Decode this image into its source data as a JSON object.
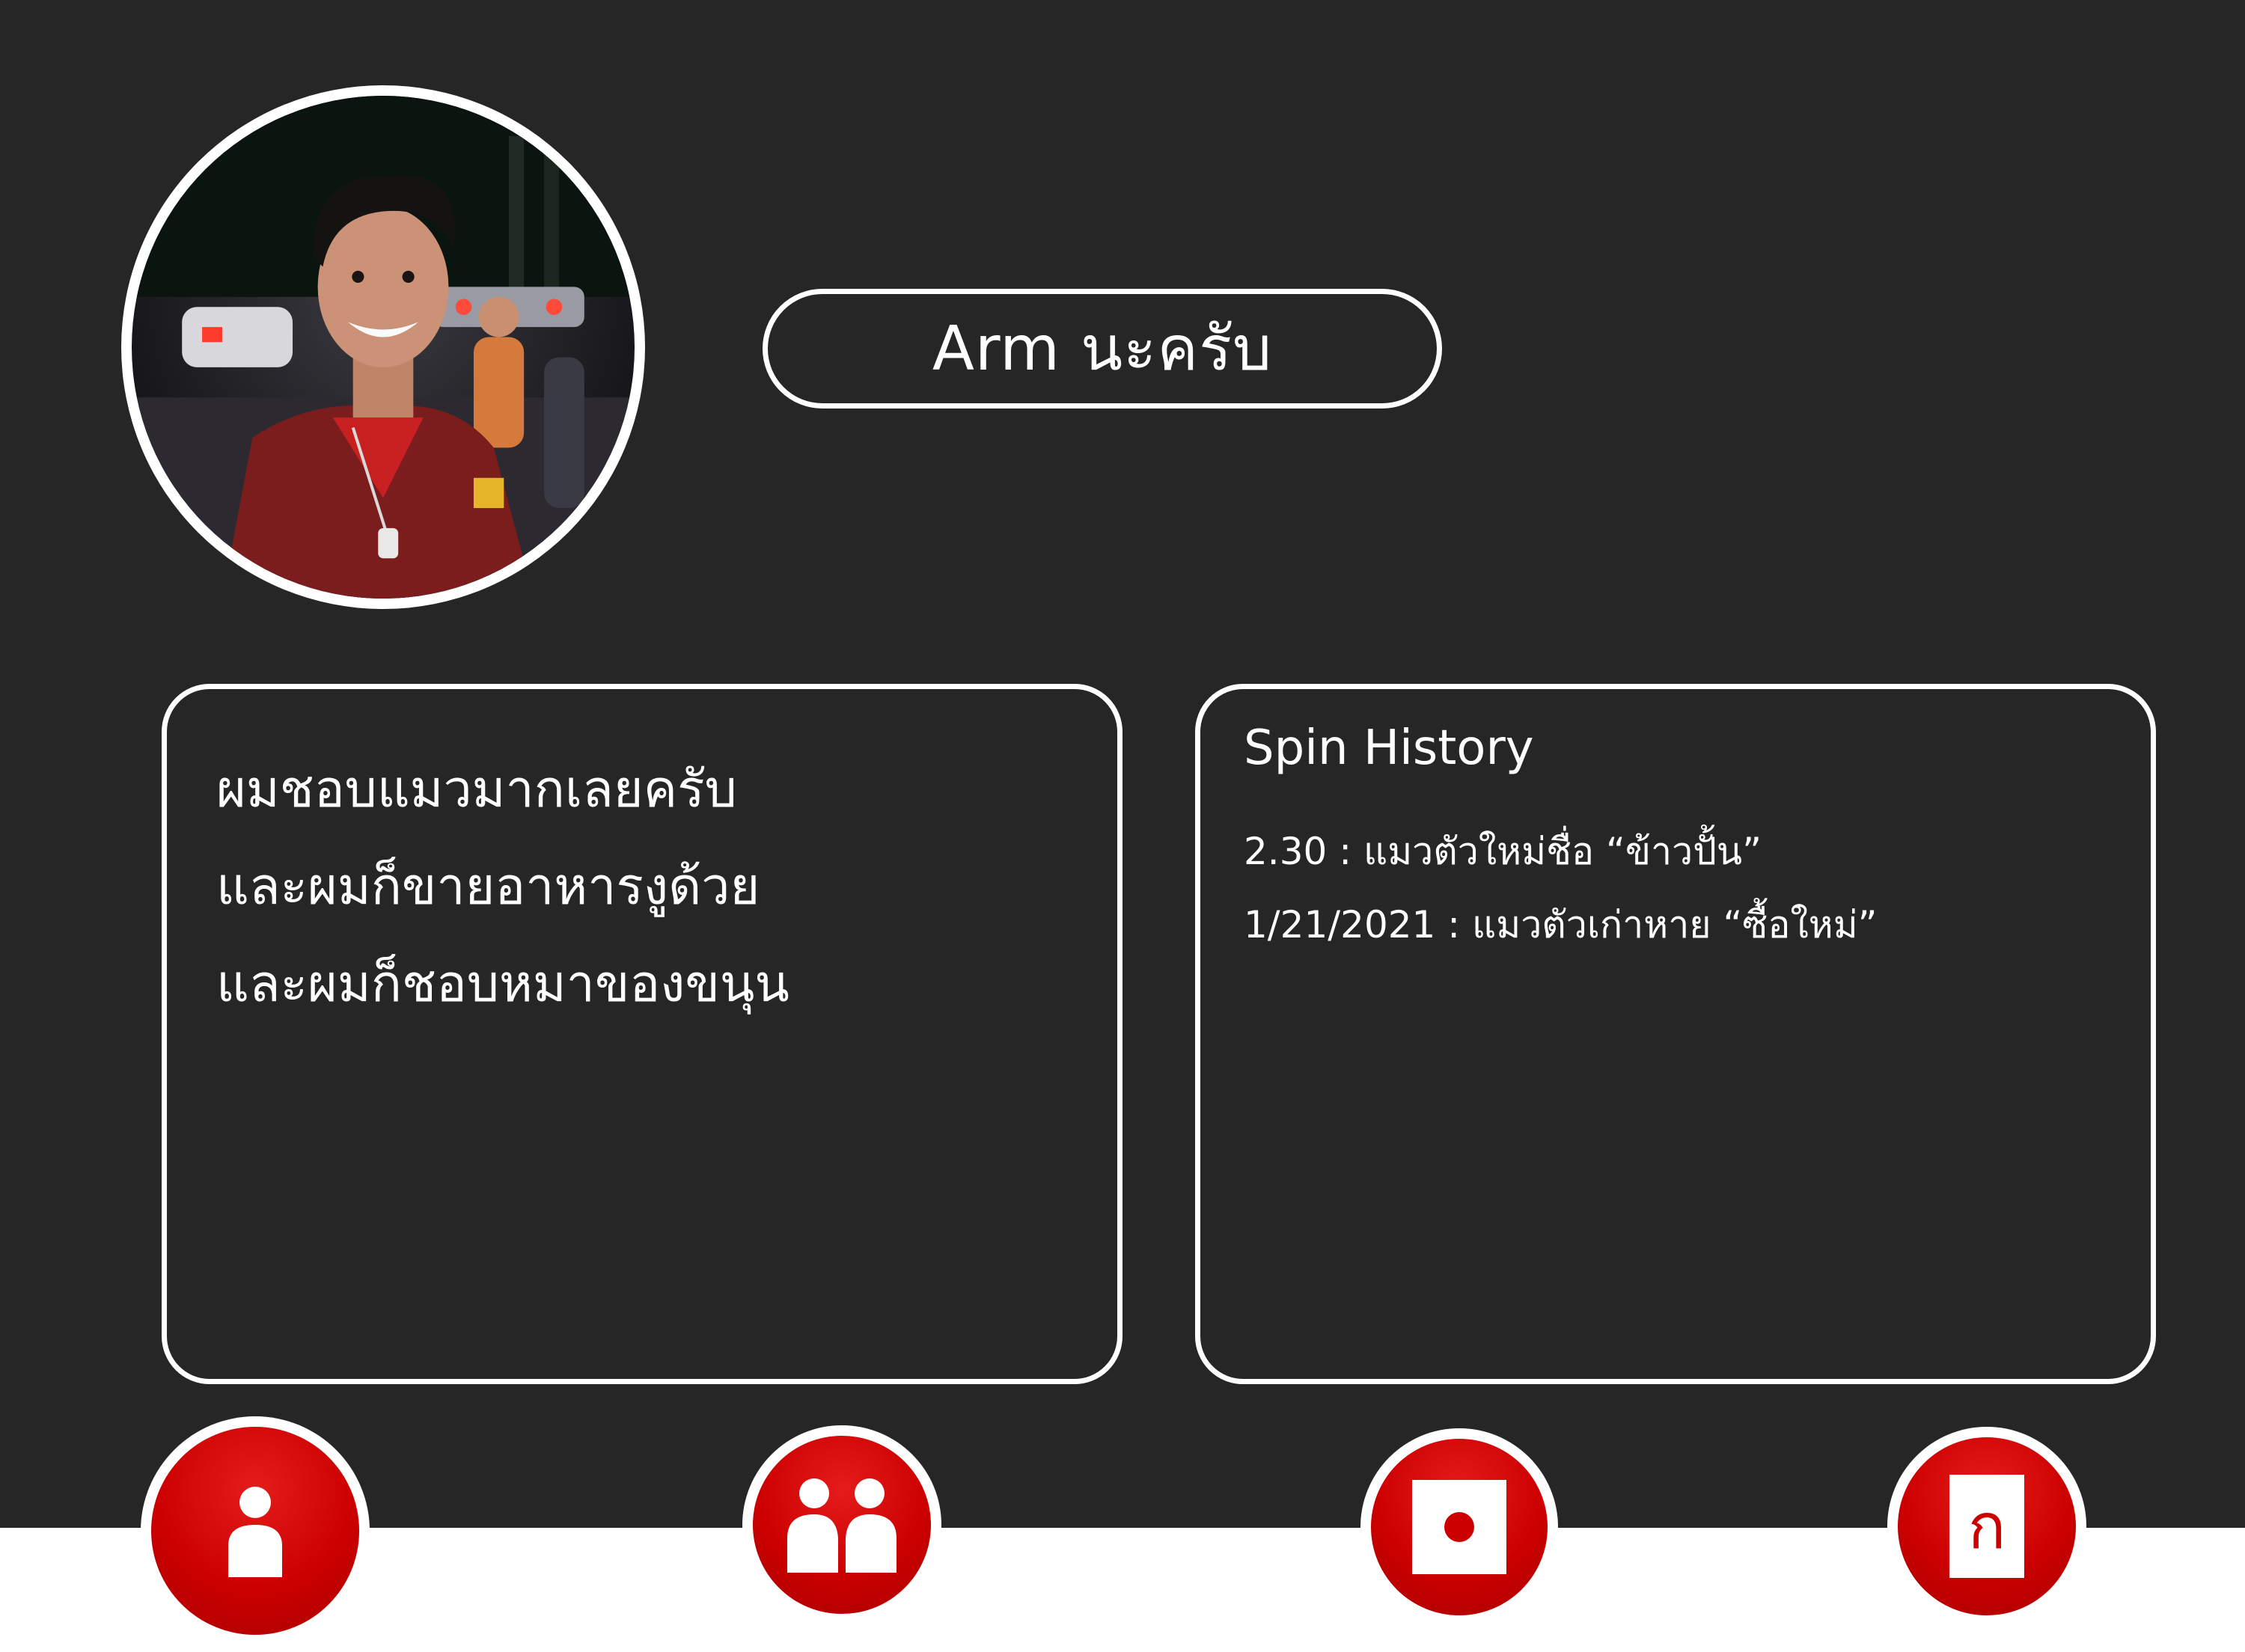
{
  "profile": {
    "name": "Arm นะครับ"
  },
  "bio": {
    "lines": [
      "ผมชอบแมวมากเลยครับ",
      "และผมก็ขายอาหารงูด้วย",
      "และผมก็ชอบหมาของขนุน"
    ]
  },
  "history": {
    "title": "Spin History",
    "items": [
      "2.30 : แมวตัวใหม่ชื่อ “ข้าวปั้น”",
      "1/21/2021 : แมวตัวเก่าหาย “ซื้อใหม่”"
    ]
  },
  "nav": {
    "items": [
      {
        "icon": "person-icon"
      },
      {
        "icon": "friends-icon"
      },
      {
        "icon": "spin-icon"
      },
      {
        "icon": "document-icon",
        "glyph": "ก"
      }
    ]
  },
  "colors": {
    "background": "#262626",
    "accent": "#cc0000",
    "outline": "#ffffff",
    "footer": "#ffffff"
  }
}
